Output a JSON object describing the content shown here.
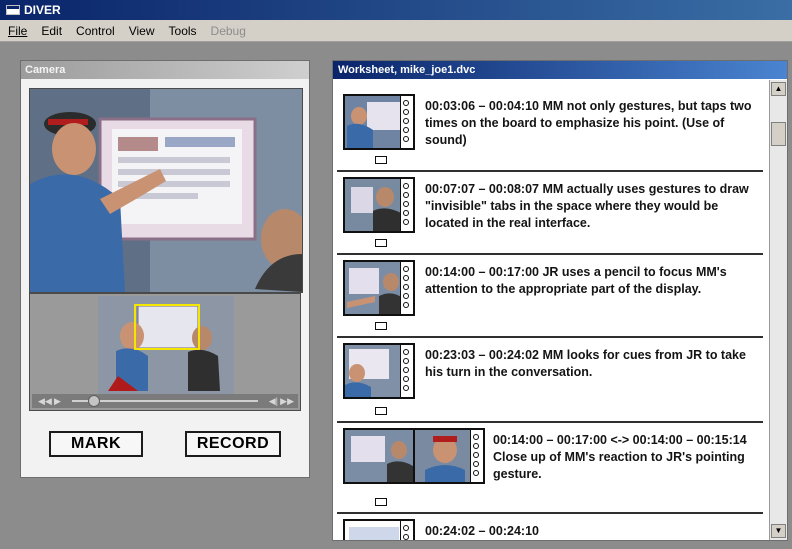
{
  "window": {
    "title": "DIVER"
  },
  "menu": [
    {
      "label": "File",
      "enabled": true
    },
    {
      "label": "Edit",
      "enabled": true
    },
    {
      "label": "Control",
      "enabled": true
    },
    {
      "label": "View",
      "enabled": true
    },
    {
      "label": "Tools",
      "enabled": true
    },
    {
      "label": "Debug",
      "enabled": false
    }
  ],
  "camera": {
    "title": "Camera",
    "mark_label": "MARK",
    "record_label": "RECORD",
    "playback_position": 0.1
  },
  "worksheet": {
    "title": "Worksheet, mike_joe1.dvc",
    "items": [
      {
        "text": "00:03:06 – 00:04:10 MM not only gestures, but taps two times on the board to emphasize his point. (Use of sound)"
      },
      {
        "text": "00:07:07 – 00:08:07 MM actually uses gestures to draw \"invisible\" tabs in the space where they would be located in the real interface."
      },
      {
        "text": "00:14:00 – 00:17:00 JR uses a pencil to focus MM's attention to the appropriate part of the display."
      },
      {
        "text": "00:23:03 – 00:24:02 MM looks for cues from JR to take his turn in the conversation."
      },
      {
        "text": "00:14:00 – 00:17:00 <-> 00:14:00 – 00:15:14 Close up of MM's reaction to JR's pointing gesture."
      },
      {
        "text": "00:24:02 – 00:24:10"
      }
    ]
  }
}
